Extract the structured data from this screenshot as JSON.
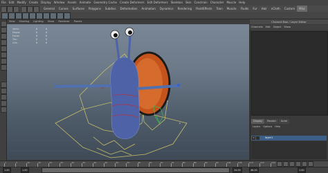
{
  "menubar": {
    "items": [
      "File",
      "Edit",
      "Modify",
      "Create",
      "Display",
      "Window",
      "Assets",
      "Animate",
      "Geometry Cache",
      "Create Deformers",
      "Edit Deformers",
      "Skeleton",
      "Skin",
      "Constrain",
      "Character",
      "Muscle",
      "Help"
    ]
  },
  "shelf": {
    "tabs": [
      "General",
      "Curves",
      "Surfaces",
      "Polygons",
      "Subdivs",
      "Deformation",
      "Animation",
      "Dynamics",
      "Rendering",
      "PaintEffects",
      "Toon",
      "Muscle",
      "Fluids",
      "Fur",
      "Hair",
      "nCloth",
      "Custom",
      "Misc"
    ],
    "active_tab": "Misc"
  },
  "viewport": {
    "menu": [
      "View",
      "Shading",
      "Lighting",
      "Show",
      "Renderer",
      "Panels"
    ],
    "hud": [
      {
        "label": "Verts:",
        "value": "0",
        "value2": "0"
      },
      {
        "label": "Edges:",
        "value": "0",
        "value2": "0"
      },
      {
        "label": "Faces:",
        "value": "0",
        "value2": "0"
      },
      {
        "label": "Tris:",
        "value": "0",
        "value2": "0"
      },
      {
        "label": "UVs:",
        "value": "0",
        "value2": "0"
      }
    ]
  },
  "channel_box": {
    "title": "Channel Box / Layer Editor",
    "menu": [
      "Channels",
      "Edit",
      "Object",
      "Show"
    ]
  },
  "layer_editor": {
    "tabs": [
      "Display",
      "Render",
      "Anim"
    ],
    "active_tab": "Display",
    "menu": [
      "Layers",
      "Options",
      "Help"
    ],
    "row": {
      "visible": "V",
      "name": "layer1"
    }
  },
  "timeline": {
    "ticks": [
      "1",
      "5",
      "10",
      "15",
      "20",
      "25",
      "30",
      "35",
      "40",
      "45",
      "50",
      "55",
      "60",
      "65",
      "70",
      "75",
      "80",
      "85",
      "90",
      "95",
      "100",
      "105",
      "110",
      "115",
      "120"
    ]
  },
  "range": {
    "start": "1.00",
    "end": "24.00",
    "anim_end": "48.00",
    "current": "1.00"
  },
  "colors": {
    "viewport_top": "#7b8897",
    "viewport_bottom": "#3f4a57",
    "snail_body": "#4e62a8",
    "shell": "#c5541c",
    "rig_yellow": "#c8c06a",
    "rig_red": "#b8303a",
    "layer_row": "#3b5f86"
  }
}
